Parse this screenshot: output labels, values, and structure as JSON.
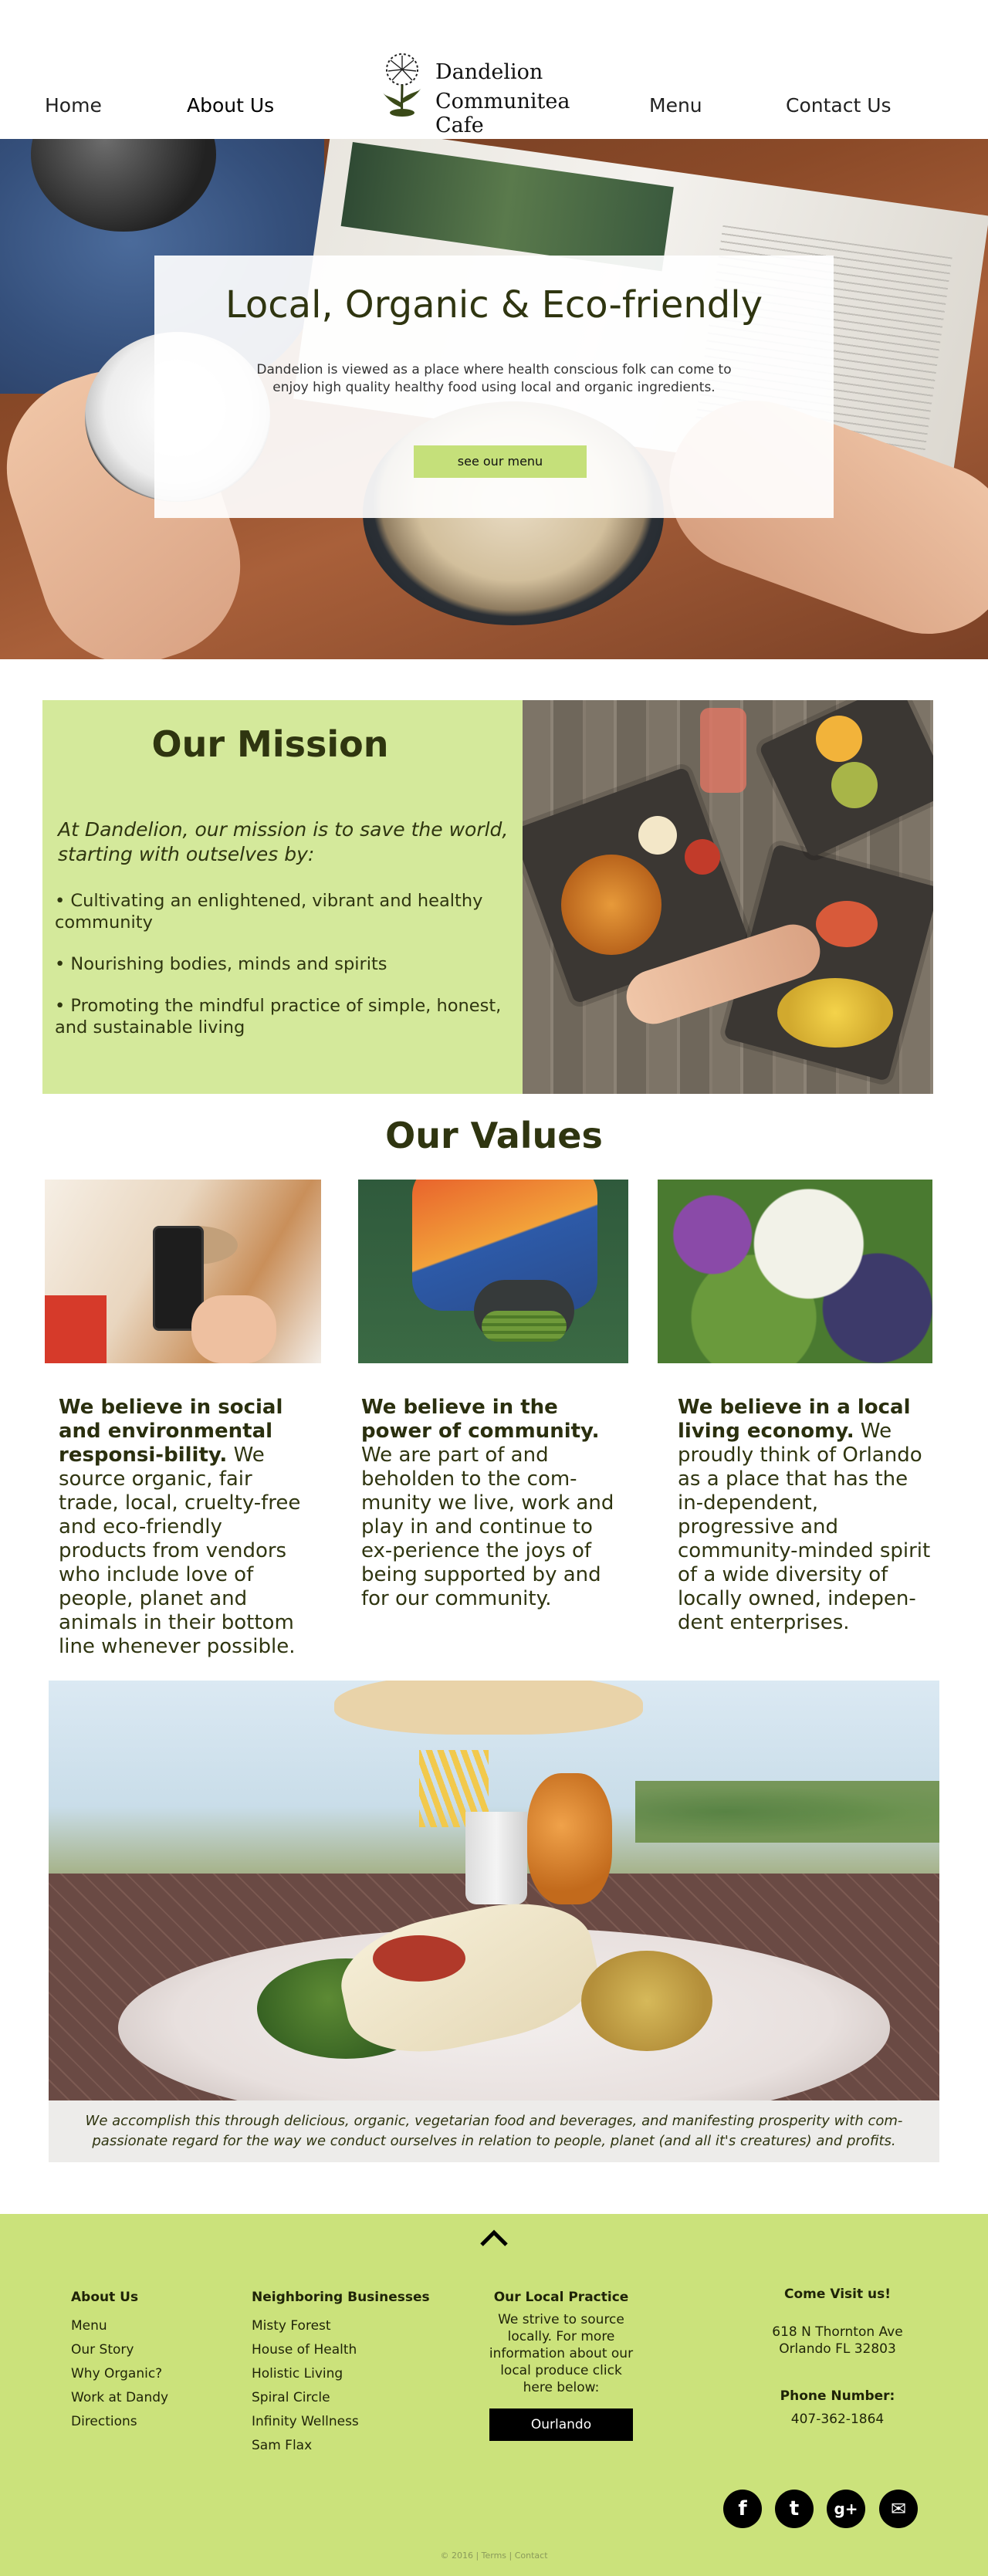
{
  "nav": {
    "home": "Home",
    "about": "About Us",
    "menu": "Menu",
    "contact": "Contact Us"
  },
  "logo": {
    "line1": "Dandelion",
    "line2": "Communitea Cafe"
  },
  "hero": {
    "title": "Local, Organic & Eco-friendly",
    "subtitle": "Dandelion is viewed as a place where health conscious folk can come to enjoy high quality healthy food using local and organic ingredients.",
    "button": "see our menu"
  },
  "mission": {
    "title": "Our Mission",
    "intro": "At Dandelion, our mission is to save the world, starting with outselves by:",
    "bullets": [
      "• Cultivating an enlightened, vibrant and healthy community",
      "• Nourishing bodies, minds and spirits",
      "• Promoting the mindful practice of simple, honest, and sustainable living"
    ]
  },
  "values": {
    "title": "Our Values",
    "items": [
      {
        "lead": "We believe in social and environmental responsi-bility.",
        "body": " We source organic, fair trade, local, cruelty-free and eco-friendly products from vendors who include love of people, planet and animals in their bottom line whenever possible."
      },
      {
        "lead": "We believe in the power of community.",
        "body": " We are part of and beholden to the com-munity we live, work and play in and continue to ex-perience the joys of being supported by and for our community."
      },
      {
        "lead": "We believe in a local living economy.",
        "body": " We proudly think of Orlando as a place that has the in-dependent, progressive and community-minded spirit of a wide diversity of locally owned, indepen-dent enterprises."
      }
    ]
  },
  "caption": "We accomplish this through delicious, organic, vegetarian food and beverages, and manifesting prosperity with com-passionate regard for the way we conduct ourselves in relation to people, planet (and all it's creatures) and profits.",
  "footer": {
    "about": {
      "head": "About Us",
      "links": [
        "Menu",
        "Our Story",
        "Why Organic?",
        "Work at Dandy",
        "Directions"
      ]
    },
    "neighbors": {
      "head": "Neighboring Businesses",
      "links": [
        "Misty Forest",
        "House of Health",
        "Holistic Living",
        "Spiral Circle",
        "Infinity Wellness",
        "Sam Flax"
      ]
    },
    "practice": {
      "head": "Our Local Practice",
      "body": "We strive to source locally. For more information about our local produce click here below:",
      "button": "Ourlando"
    },
    "visit": {
      "head": "Come Visit us!",
      "address1": "618 N Thornton Ave",
      "address2": "Orlando FL 32803",
      "phone_head": "Phone Number:",
      "phone": "407-362-1864"
    },
    "social": [
      "f",
      "t",
      "g+",
      "✉"
    ],
    "legal": "© 2016 | Terms | Contact"
  },
  "colors": {
    "accent_green": "#cbe27b",
    "mission_bg": "#d4e99b",
    "button_green": "#c5e07a",
    "text_dark": "#2f3510"
  }
}
